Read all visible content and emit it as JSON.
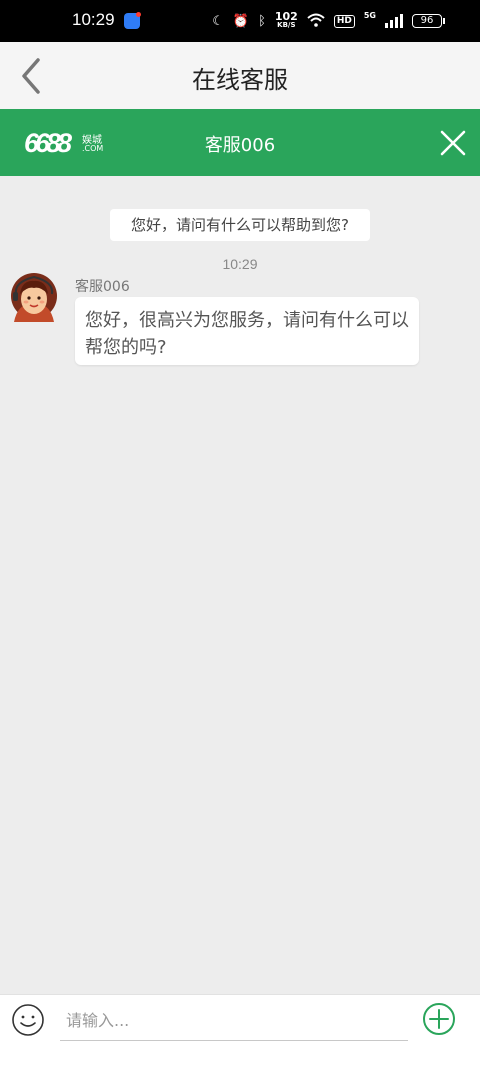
{
  "status_bar": {
    "time": "10:29",
    "speed_value": "102",
    "speed_unit": "KB/S",
    "hd_label": "HD",
    "network_label": "5G",
    "battery": "96"
  },
  "header": {
    "title": "在线客服",
    "back_icon": "chevron-left-icon"
  },
  "agent_bar": {
    "brand_number": "6688",
    "brand_cn": "娱城",
    "brand_domain": ".COM",
    "agent_name": "客服006",
    "close_icon": "close-icon",
    "color": "#2aa55b"
  },
  "chat": {
    "welcome": "您好，请问有什么可以帮助到您?",
    "timestamp": "10:29",
    "messages": [
      {
        "sender": "客服006",
        "text": "您好，很高兴为您服务，请问有什么可以帮您的吗?"
      }
    ]
  },
  "input_bar": {
    "placeholder": "请输入...",
    "value": "",
    "emoji_icon": "emoji-smile-icon",
    "add_icon": "plus-circle-icon",
    "accent": "#2aa55b"
  }
}
